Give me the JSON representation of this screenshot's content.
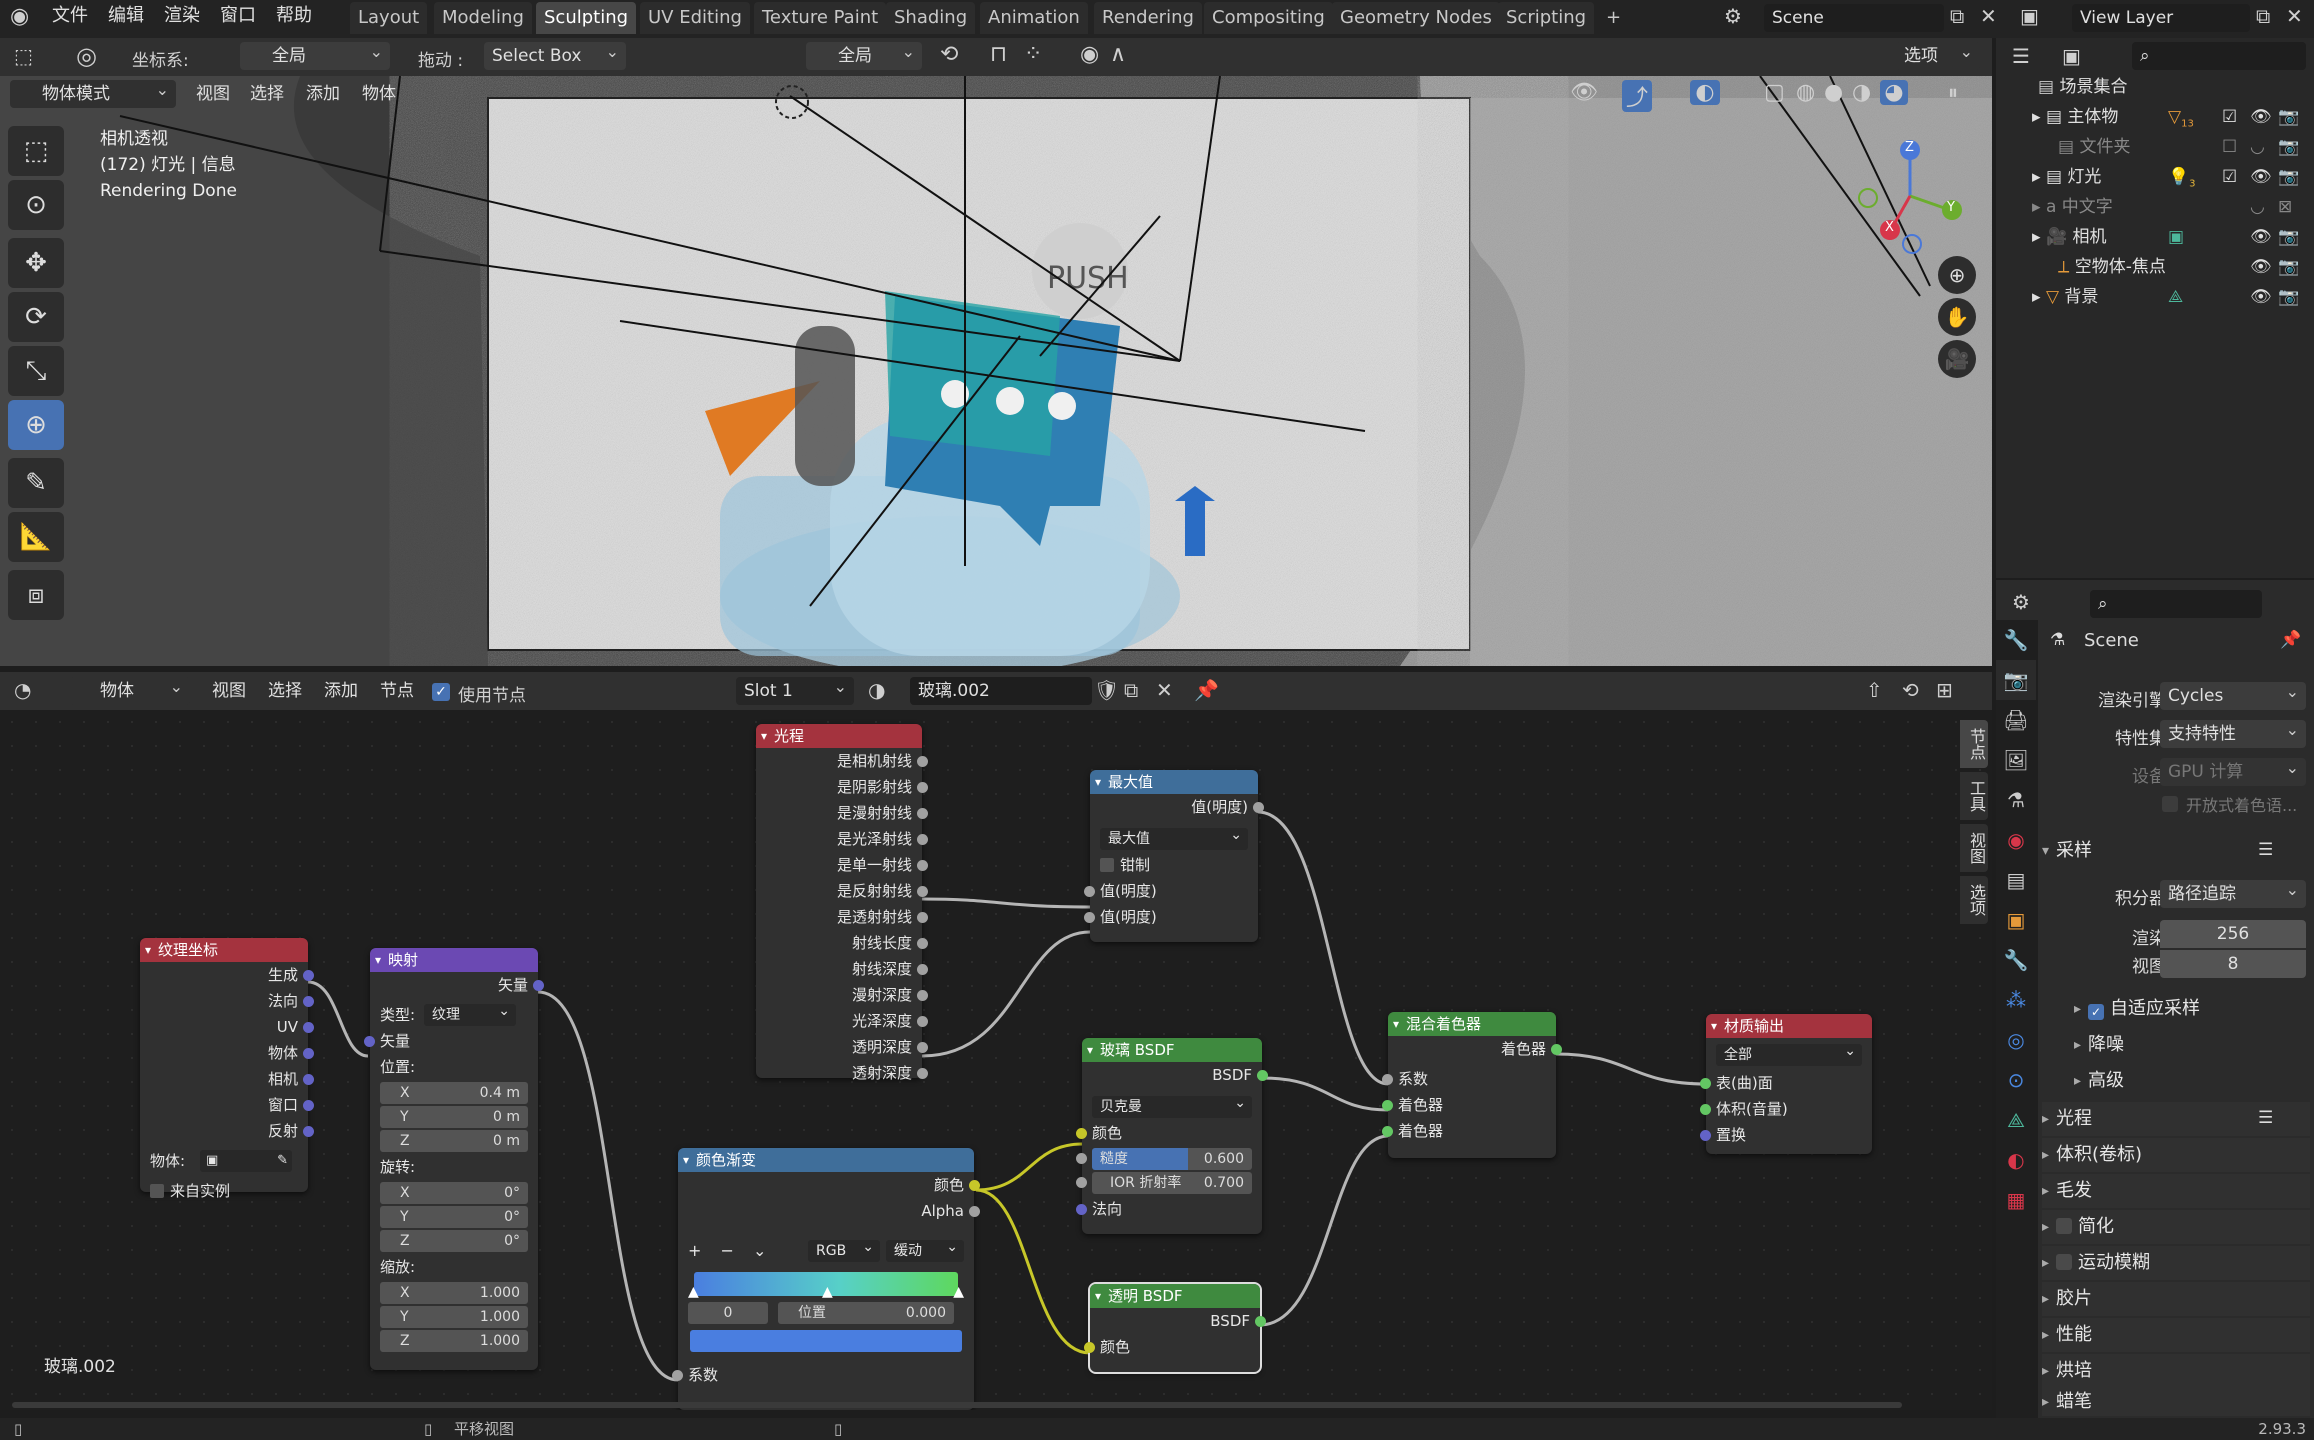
{
  "topbar": {
    "menus": [
      "文件",
      "编辑",
      "渲染",
      "窗口",
      "帮助"
    ],
    "workspaces": [
      "Layout",
      "Modeling",
      "Sculpting",
      "UV Editing",
      "Texture Paint",
      "Shading",
      "Animation",
      "Rendering",
      "Compositing",
      "Geometry Nodes",
      "Scripting"
    ],
    "active_workspace": "Sculpting",
    "add_tab": "+",
    "scene": "Scene",
    "view_layer": "View Layer"
  },
  "vp_header": {
    "coord_label": "坐标系:",
    "coord_value": "全局",
    "drag_label": "拖动 :",
    "drag_value": "Select Box",
    "pivot_value": "全局",
    "options": "选项",
    "mode": "物体模式",
    "menus": [
      "视图",
      "选择",
      "添加",
      "物体"
    ]
  },
  "viewport": {
    "info_line1": "相机透视",
    "info_line2": "(172) 灯光 | 信息",
    "info_line3": "Rendering Done",
    "render_text": "PUSH",
    "gizmo": {
      "x": "X",
      "y": "Y",
      "z": "Z"
    }
  },
  "node_header": {
    "object_mode": "物体",
    "menus": [
      "视图",
      "选择",
      "添加",
      "节点"
    ],
    "use_nodes": "使用节点",
    "slot": "Slot 1",
    "material": "玻璃.002"
  },
  "nodes": {
    "texcoord": {
      "title": "纹理坐标",
      "outputs": [
        "生成",
        "法向",
        "UV",
        "物体",
        "相机",
        "窗口",
        "反射"
      ],
      "object_label": "物体:",
      "from_instancer": "来自实例"
    },
    "mapping": {
      "title": "映射",
      "out": "矢量",
      "type_label": "类型:",
      "type_value": "纹理",
      "vec_in": "矢量",
      "loc_label": "位置:",
      "loc": [
        "0.4 m",
        "0 m",
        "0 m"
      ],
      "rot_label": "旋转:",
      "rot": [
        "0°",
        "0°",
        "0°"
      ],
      "scale_label": "缩放:",
      "scale": [
        "1.000",
        "1.000",
        "1.000"
      ],
      "axes": [
        "X",
        "Y",
        "Z"
      ]
    },
    "lightpath": {
      "title": "光程",
      "outputs": [
        "是相机射线",
        "是阴影射线",
        "是漫射射线",
        "是光泽射线",
        "是单一射线",
        "是反射射线",
        "是透射射线",
        "射线长度",
        "射线深度",
        "漫射深度",
        "光泽深度",
        "透明深度",
        "透射深度"
      ]
    },
    "max": {
      "title": "最大值",
      "out": "值(明度)",
      "op": "最大值",
      "clamp": "钳制",
      "in1": "值(明度)",
      "in2": "值(明度)"
    },
    "glass": {
      "title": "玻璃 BSDF",
      "out": "BSDF",
      "dist": "贝克曼",
      "color": "颜色",
      "rough_label": "糙度",
      "rough_value": "0.600",
      "ior_label": "IOR 折射率",
      "ior_value": "0.700",
      "normal": "法向"
    },
    "ramp": {
      "title": "颜色渐变",
      "out_color": "颜色",
      "out_alpha": "Alpha",
      "plus": "+",
      "minus": "−",
      "chev": "⌄",
      "mode": "RGB",
      "interp": "缓动",
      "index": "0",
      "pos_label": "位置",
      "pos_value": "0.000",
      "fac": "系数"
    },
    "transparent": {
      "title": "透明 BSDF",
      "out": "BSDF",
      "color": "颜色"
    },
    "mix": {
      "title": "混合着色器",
      "out": "着色器",
      "fac": "系数",
      "sh1": "着色器",
      "sh2": "着色器"
    },
    "output": {
      "title": "材质输出",
      "target": "全部",
      "surface": "表(曲)面",
      "volume": "体积(音量)",
      "disp": "置换"
    }
  },
  "node_editor": {
    "material_name": "玻璃.002",
    "sidebar_tabs": [
      "节点",
      "工具",
      "视图",
      "选项"
    ]
  },
  "outliner": {
    "root": "场景集合",
    "items": [
      {
        "label": "主体物",
        "badge": "13"
      },
      {
        "label": "文件夹",
        "badge": ""
      },
      {
        "label": "灯光",
        "badge": "3"
      },
      {
        "label": "中文字",
        "badge": ""
      },
      {
        "label": "相机",
        "badge": ""
      },
      {
        "label": "空物体-焦点",
        "badge": ""
      },
      {
        "label": "背景",
        "badge": ""
      }
    ]
  },
  "properties": {
    "scene": "Scene",
    "engine_label": "渲染引擎",
    "engine": "Cycles",
    "feature_label": "特性集",
    "feature": "支持特性",
    "device_label": "设备",
    "device": "GPU 计算",
    "osl": "开放式着色语...",
    "sampling": "采样",
    "integrator_label": "积分器",
    "integrator": "路径追踪",
    "render_label": "渲染",
    "render": "256",
    "view_label": "视图",
    "view": "8",
    "adaptive": "自适应采样",
    "denoise": "降噪",
    "advanced": "高级",
    "light_paths": "光程",
    "volumes": "体积(卷标)",
    "hair": "毛发",
    "simplify": "简化",
    "motion_blur": "运动模糊",
    "film": "胶片",
    "performance": "性能",
    "bake": "烘培",
    "more": "蜡笔"
  },
  "status": {
    "pan": "平移视图",
    "version": "2.93.3"
  },
  "colors": {
    "accent": "#4772b3",
    "node_red": "#a4333e",
    "node_purple": "#6b49b3",
    "node_blue": "#3f6e9a",
    "node_green": "#3f8a3f"
  }
}
